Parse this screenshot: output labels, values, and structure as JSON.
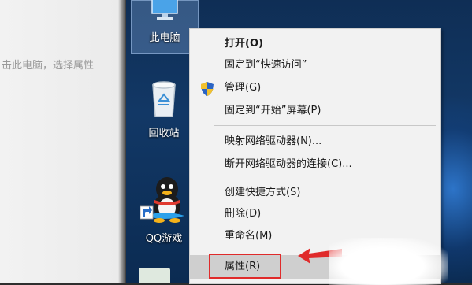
{
  "instruction_text": "击此电脑，选择属性",
  "desktop_icons": {
    "this_pc": "此电脑",
    "recycle_bin": "回收站",
    "qq_games": "QQ游戏"
  },
  "context_menu": {
    "open": "打开(O)",
    "pin_quick_access": "固定到“快速访问”",
    "manage": "管理(G)",
    "pin_start": "固定到“开始”屏幕(P)",
    "map_drive": "映射网络驱动器(N)...",
    "disconnect_drive": "断开网络驱动器的连接(C)...",
    "create_shortcut": "创建快捷方式(S)",
    "delete": "删除(D)",
    "rename": "重命名(M)",
    "properties": "属性(R)"
  },
  "colors": {
    "highlight_box": "#e02b2b",
    "menu_bg": "#f2f2f2",
    "desktop_bg": "#123866"
  },
  "icons": [
    "monitor-icon",
    "recycle-bin-icon",
    "qq-penguin-icon",
    "shortcut-arrow-icon",
    "uac-shield-icon",
    "red-arrow-icon"
  ]
}
